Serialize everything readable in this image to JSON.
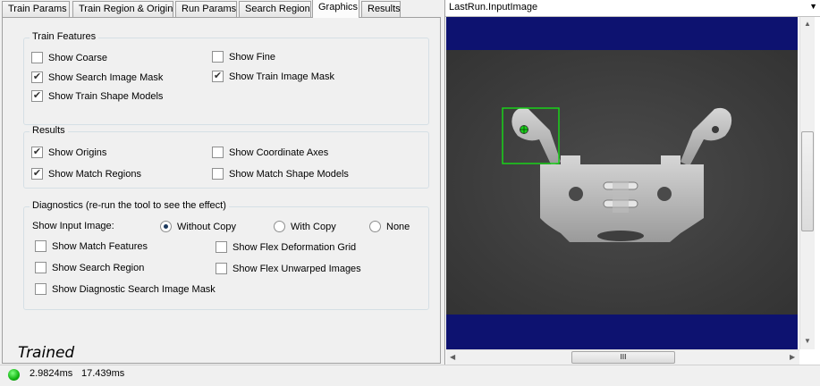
{
  "tabs": [
    "Train Params",
    "Train Region & Origin",
    "Run Params",
    "Search Region",
    "Graphics",
    "Results"
  ],
  "active_tab": "Graphics",
  "train_features": {
    "title": "Train Features",
    "show_coarse": "Show Coarse",
    "show_fine": "Show Fine",
    "show_search_image_mask": "Show Search Image Mask",
    "show_train_image_mask": "Show Train Image Mask",
    "show_train_shape_models": "Show Train Shape Models"
  },
  "results": {
    "title": "Results",
    "show_origins": "Show Origins",
    "show_coordinate_axes": "Show Coordinate Axes",
    "show_match_regions": "Show Match Regions",
    "show_match_shape_models": "Show Match Shape Models"
  },
  "diagnostics": {
    "title": "Diagnostics (re-run the tool to see the effect)",
    "input_image_label": "Show Input Image:",
    "without_copy": "Without Copy",
    "with_copy": "With Copy",
    "none": "None",
    "show_match_features": "Show Match Features",
    "show_flex_deformation_grid": "Show Flex Deformation Grid",
    "show_search_region": "Show Search Region",
    "show_flex_unwarped_images": "Show Flex Unwarped Images",
    "show_diagnostic_search_image_mask": "Show Diagnostic Search Image Mask"
  },
  "checked": {
    "show_coarse": false,
    "show_fine": false,
    "show_search_image_mask": true,
    "show_train_image_mask": true,
    "show_train_shape_models": true,
    "show_origins": true,
    "show_coordinate_axes": false,
    "show_match_regions": true,
    "show_match_shape_models": false,
    "show_match_features": false,
    "show_flex_deformation_grid": false,
    "show_search_region": false,
    "show_flex_unwarped_images": false,
    "show_diagnostic_search_image_mask": false
  },
  "input_image_selected": "Without Copy",
  "status_label": "Trained",
  "status_bar": {
    "time1": "2.9824ms",
    "time2": "17.439ms",
    "status_color": "#11b411"
  },
  "image_selector": {
    "value": "LastRun.InputImage"
  },
  "hscroll_grip": "III",
  "colors": {
    "viewer_bg": "#0d1270",
    "match_box": "#19d219"
  }
}
